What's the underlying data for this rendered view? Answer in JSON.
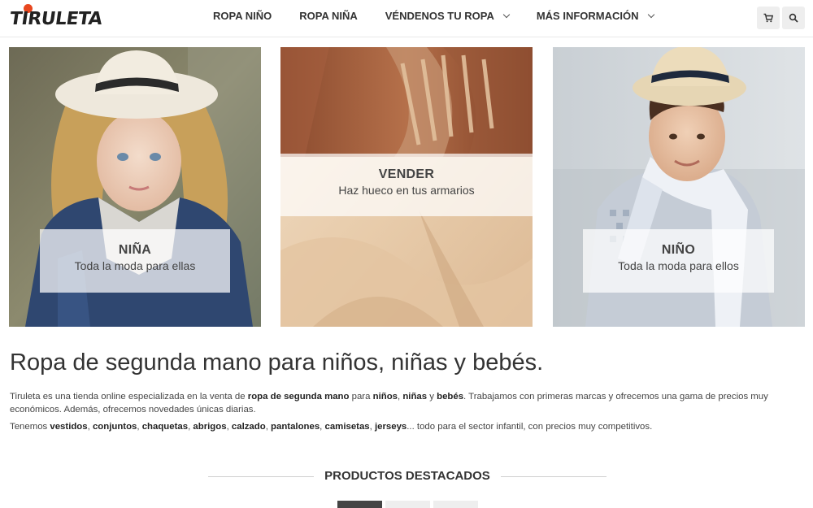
{
  "brand": {
    "name": "TIRULETA",
    "accent": "#e8471f"
  },
  "nav": {
    "items": [
      {
        "label": "ROPA NIÑO",
        "has_dropdown": false
      },
      {
        "label": "ROPA NIÑA",
        "has_dropdown": false
      },
      {
        "label": "VÉNDENOS TU ROPA",
        "has_dropdown": true
      },
      {
        "label": "MÁS INFORMACIÓN",
        "has_dropdown": true
      }
    ],
    "icons": [
      "cart-icon",
      "search-icon"
    ]
  },
  "tiles": [
    {
      "title": "NIÑA",
      "subtitle": "Toda la moda para ellas"
    },
    {
      "title": "VENDER",
      "subtitle": "Haz hueco en tus armarios"
    },
    {
      "title": "NIÑO",
      "subtitle": "Toda la moda para ellos"
    }
  ],
  "main": {
    "headline": "Ropa de segunda mano para niños, niñas y bebés.",
    "p1": {
      "t1": "Tiruleta es una tienda online especializada en la venta de ",
      "b1": "ropa de segunda mano",
      "t2": " para ",
      "b2": "niños",
      "t3": ", ",
      "b3": "niñas",
      "t4": " y ",
      "b4": "bebés",
      "t5": ". Trabajamos con primeras marcas y ofrecemos una gama de precios muy económicos. Además, ofrecemos novedades únicas diarias."
    },
    "p2": {
      "t0": "Tenemos ",
      "b1": "vestidos",
      "s1": ", ",
      "b2": "conjuntos",
      "s2": ", ",
      "b3": "chaquetas",
      "s3": ", ",
      "b4": "abrigos",
      "s4": ", ",
      "b5": "calzado",
      "s5": ", ",
      "b6": "pantalones",
      "s6": ", ",
      "b7": "camisetas",
      "s7": ", ",
      "b8": "jerseys",
      "t9": "... todo para el sector infantil, con precios muy competitivos."
    },
    "featured_title": "PRODUCTOS DESTACADOS"
  }
}
